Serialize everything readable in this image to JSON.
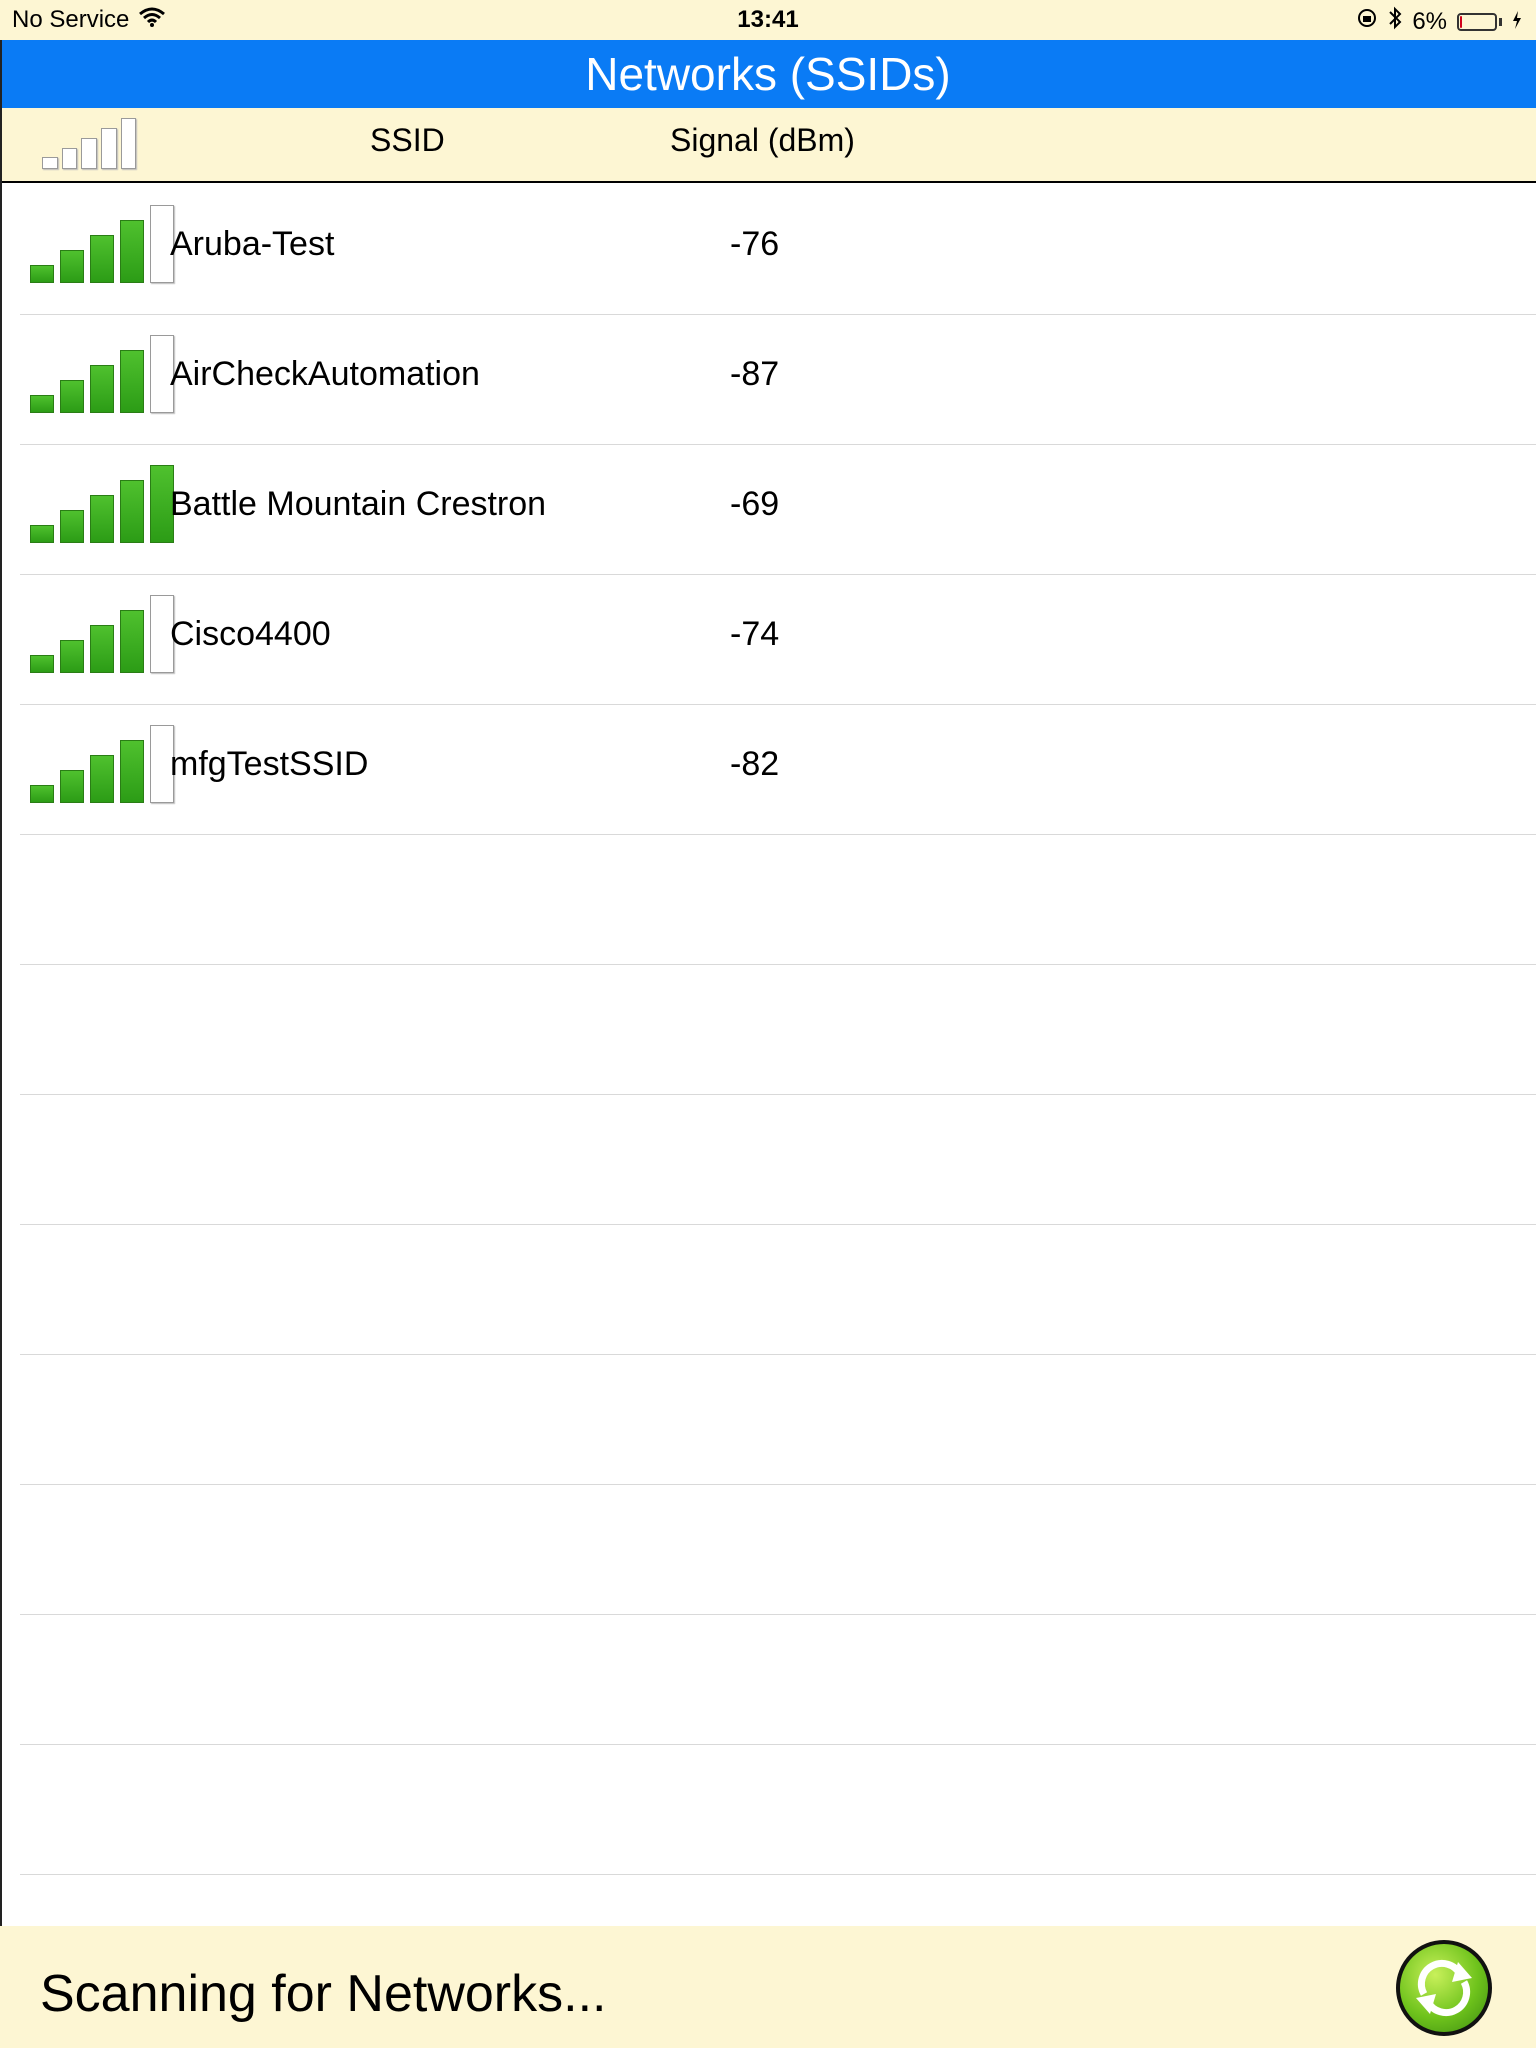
{
  "status_bar": {
    "carrier": "No Service",
    "time": "13:41",
    "battery": "6%",
    "battery_level": 0.06
  },
  "title": "Networks (SSIDs)",
  "columns": {
    "ssid": "SSID",
    "signal": "Signal (dBm)"
  },
  "networks": [
    {
      "ssid": "Aruba-Test",
      "signal": "-76",
      "bars": 4
    },
    {
      "ssid": "AirCheckAutomation",
      "signal": "-87",
      "bars": 4
    },
    {
      "ssid": "Battle Mountain Crestron",
      "signal": "-69",
      "bars": 5
    },
    {
      "ssid": "Cisco4400",
      "signal": "-74",
      "bars": 4
    },
    {
      "ssid": "mfgTestSSID",
      "signal": "-82",
      "bars": 4
    }
  ],
  "empty_rows": 8,
  "footer": {
    "status": "Scanning for Networks..."
  },
  "colors": {
    "title_bar": "#0a7bf5",
    "header_bg": "#fdf6d3",
    "bar_on": "#3aae1f"
  }
}
